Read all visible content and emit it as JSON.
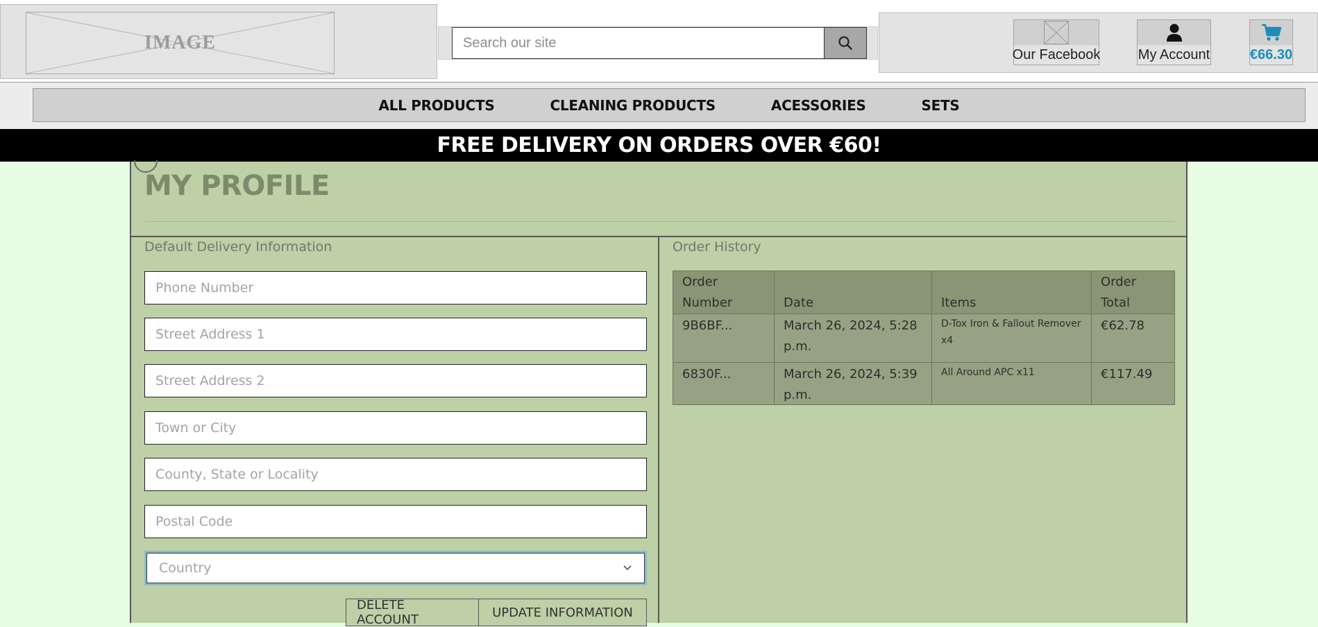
{
  "header": {
    "logo_text": "IMAGE",
    "search_placeholder": "Search our site",
    "facebook_label": "Our Facebook",
    "account_label": "My Account",
    "cart_total": "€66.30"
  },
  "nav": {
    "items": [
      "ALL PRODUCTS",
      "CLEANING PRODUCTS",
      "ACESSORIES",
      "SETS"
    ]
  },
  "banner": "FREE DELIVERY ON ORDERS OVER €60!",
  "profile": {
    "title": "MY PROFILE",
    "delivery_heading": "Default Delivery Information",
    "fields": {
      "phone": "Phone Number",
      "street1": "Street Address 1",
      "street2": "Street Address 2",
      "town": "Town or City",
      "county": "County, State or Locality",
      "postcode": "Postal Code",
      "country": "Country"
    },
    "delete_label": "DELETE ACCOUNT",
    "update_label": "UPDATE INFORMATION"
  },
  "orders": {
    "heading": "Order History",
    "columns": [
      "Order Number",
      "Date",
      "Items",
      "Order Total"
    ],
    "rows": [
      {
        "number": "9B6BF...",
        "date": "March 26, 2024, 5:28 p.m.",
        "items": "D-Tox Iron & Fallout Remover x4",
        "total": "€62.78"
      },
      {
        "number": "6830F...",
        "date": "March 26, 2024, 5:39 p.m.",
        "items": "All Around APC x11",
        "total": "€117.49"
      }
    ]
  },
  "colors": {
    "page_bg": "#e6fde3",
    "main_bg": "#bdd0a6",
    "banner_bg": "#000000",
    "cart_accent": "#1b8fb8",
    "table_bg": "#8f9a7c"
  },
  "icons": {
    "search": "search-icon",
    "account": "user-icon",
    "cart": "cart-icon",
    "dropdown": "chevron-down-icon"
  }
}
